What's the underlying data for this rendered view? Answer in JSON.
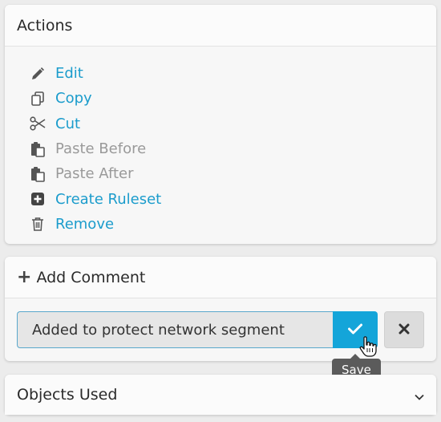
{
  "actions": {
    "title": "Actions",
    "items": [
      {
        "label": "Edit",
        "icon": "pencil-icon",
        "enabled": true
      },
      {
        "label": "Copy",
        "icon": "copy-icon",
        "enabled": true
      },
      {
        "label": "Cut",
        "icon": "scissors-icon",
        "enabled": true
      },
      {
        "label": "Paste Before",
        "icon": "paste-icon",
        "enabled": false
      },
      {
        "label": "Paste After",
        "icon": "paste-icon",
        "enabled": false
      },
      {
        "label": "Create Ruleset",
        "icon": "plus-square-icon",
        "enabled": true
      },
      {
        "label": "Remove",
        "icon": "trash-icon",
        "enabled": true
      }
    ]
  },
  "comment": {
    "title": "Add Comment",
    "value": "Added to protect network segment",
    "save_tooltip": "Save"
  },
  "objects": {
    "title": "Objects Used"
  },
  "colors": {
    "link": "#1b9ccc",
    "disabled": "#9a9a9a",
    "save_button": "#14a5d9"
  }
}
